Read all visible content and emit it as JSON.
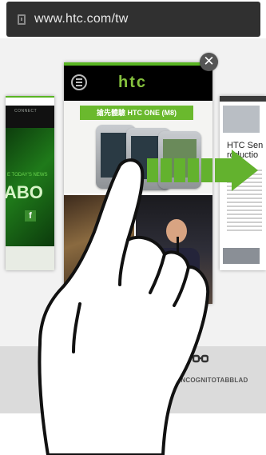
{
  "browser": {
    "url": "www.htc.com/tw"
  },
  "tabs": {
    "left_card": {
      "brand_text": "CONNECT",
      "news_text": "E TODAY'S NEWS",
      "hero_text": "ABO",
      "social_icon": "f"
    },
    "center_card": {
      "logo_text": "htc",
      "promo_button": "搶先體驗 HTC ONE (M8)"
    },
    "right_card": {
      "title": "HTC Sen\nroductio"
    },
    "close_glyph": "✕"
  },
  "bottom_bar": {
    "incognito_label": "INCOGNITOTABBLAD"
  },
  "gesture": {
    "direction": "swipe-right"
  },
  "colors": {
    "htc_green": "#6ab92d",
    "arrow_green": "#63b22e"
  }
}
